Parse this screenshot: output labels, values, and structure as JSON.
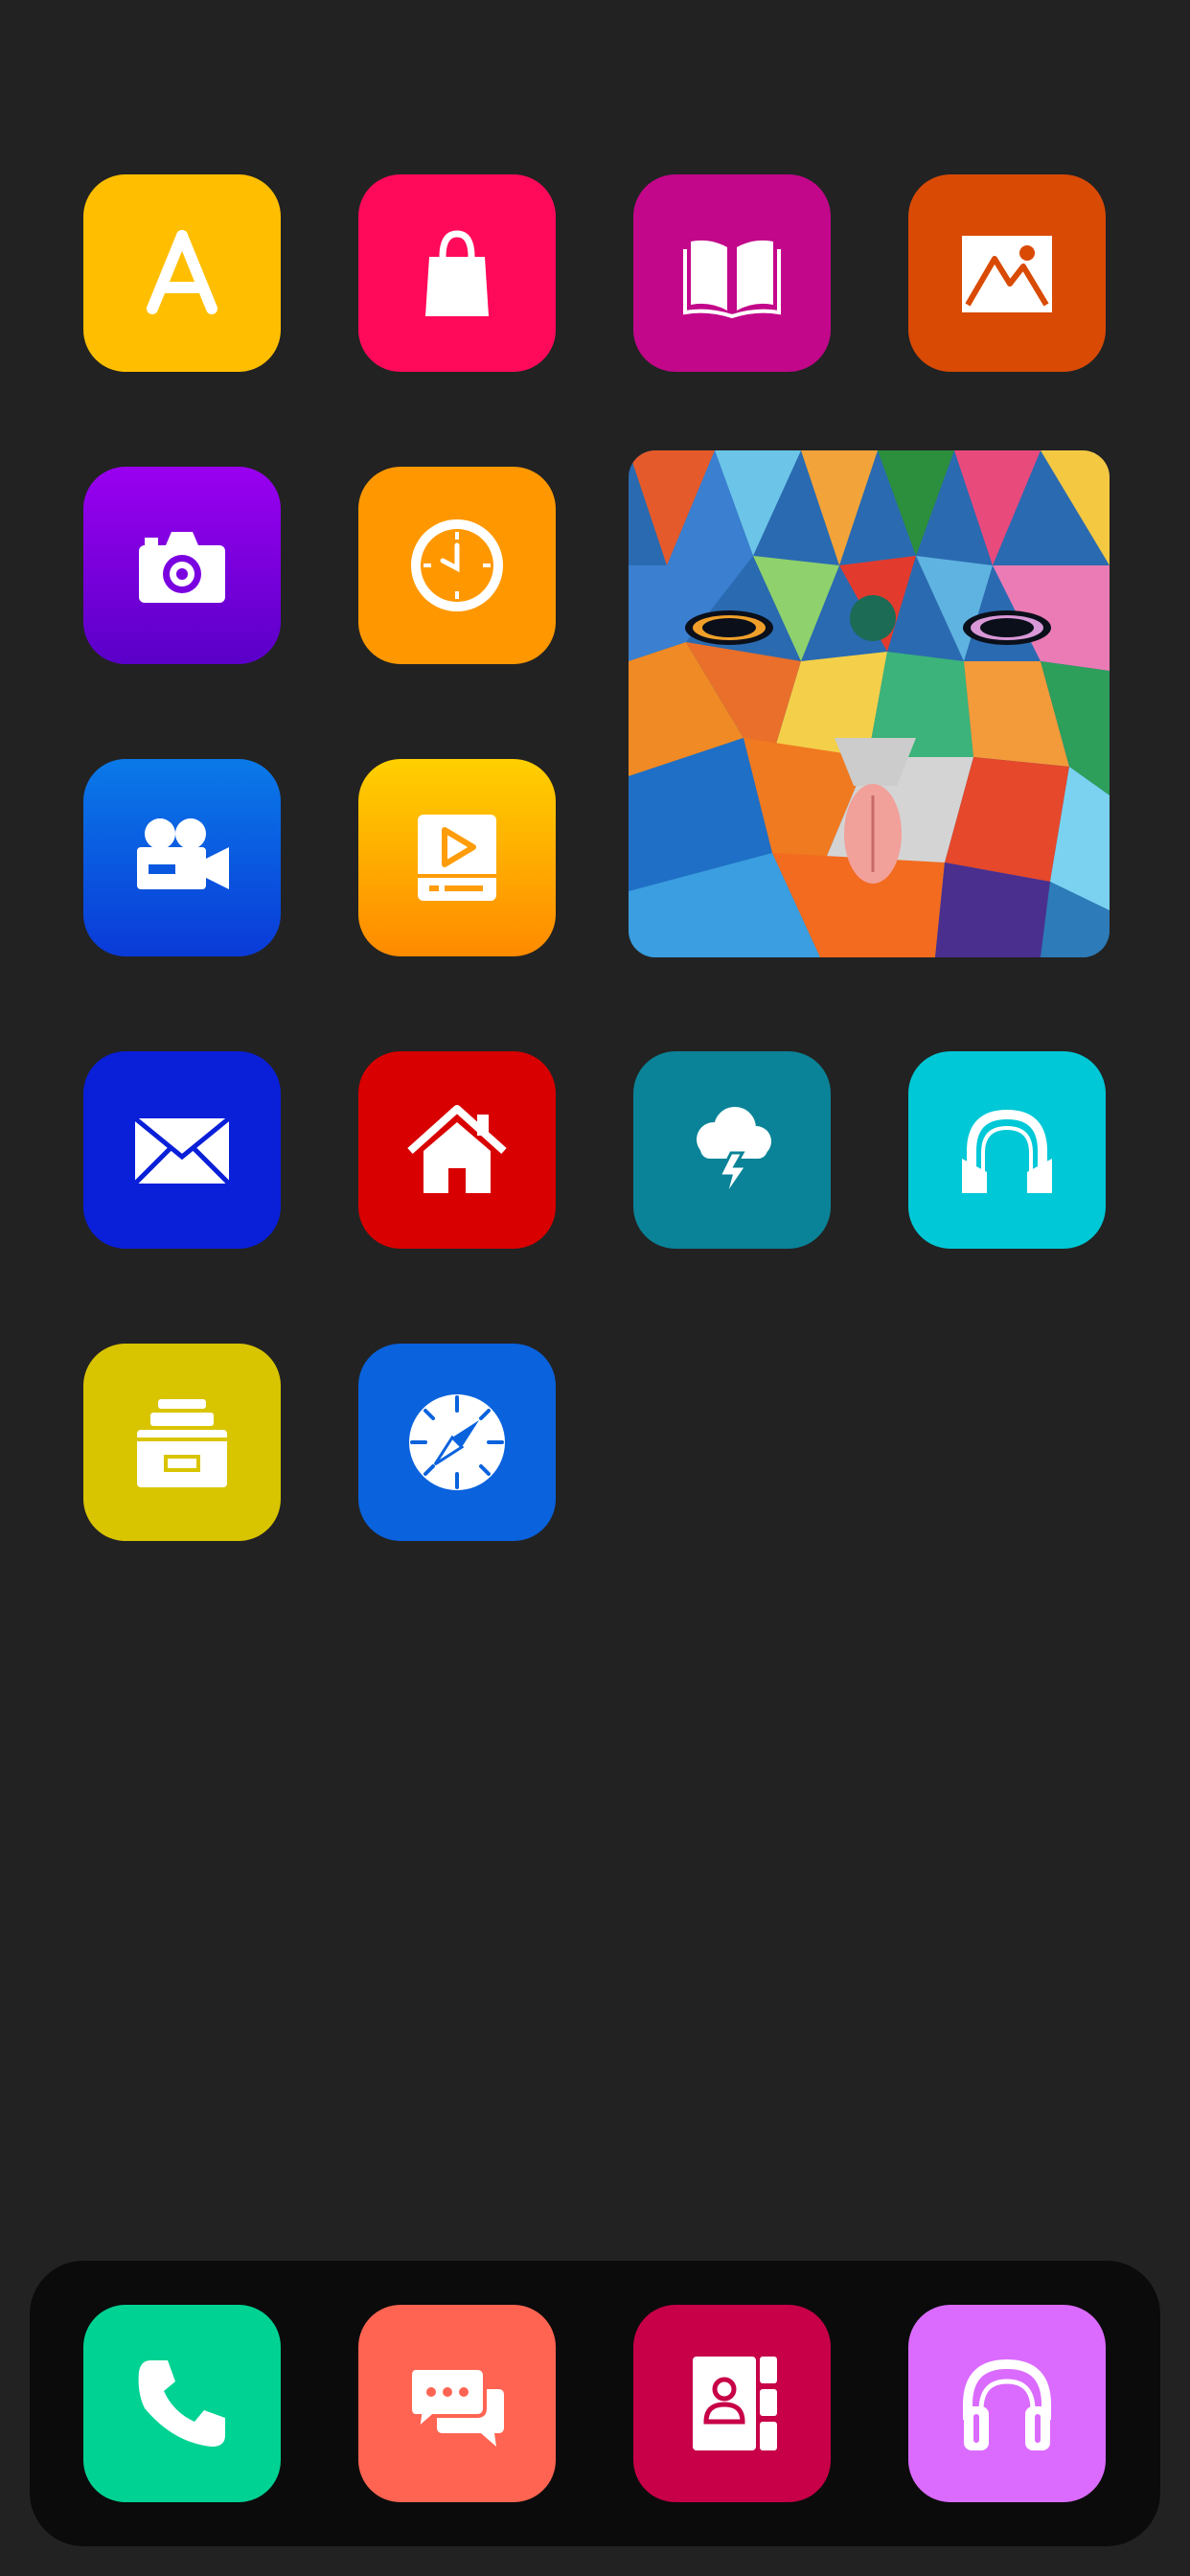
{
  "home_screen": {
    "apps": [
      {
        "id": "app-store",
        "icon": "app-store-icon",
        "color": "#FFBF00"
      },
      {
        "id": "shopping",
        "icon": "shopping-bag-icon",
        "color": "#FF0A5A"
      },
      {
        "id": "books",
        "icon": "open-book-icon",
        "color": "#C2078A"
      },
      {
        "id": "photos",
        "icon": "mountain-photo-icon",
        "color": "#D94A05"
      },
      {
        "id": "camera",
        "icon": "camera-icon",
        "color": "#7A00E0"
      },
      {
        "id": "clock",
        "icon": "clock-icon",
        "color": "#FF9800"
      },
      {
        "id": "video-camera",
        "icon": "video-camera-icon",
        "color": "#0A58E0"
      },
      {
        "id": "video-player",
        "icon": "video-player-icon",
        "color": "#FF9C0A"
      },
      {
        "id": "mail",
        "icon": "envelope-icon",
        "color": "#0A1FD8"
      },
      {
        "id": "home",
        "icon": "house-icon",
        "color": "#D80000"
      },
      {
        "id": "weather",
        "icon": "storm-cloud-icon",
        "color": "#0A8398"
      },
      {
        "id": "music",
        "icon": "headphones-icon",
        "color": "#00C8D7"
      },
      {
        "id": "files",
        "icon": "archive-box-icon",
        "color": "#D9C400"
      },
      {
        "id": "safari",
        "icon": "compass-icon",
        "color": "#0A62DD"
      }
    ],
    "widget": {
      "icon": "colorful-mural-image"
    }
  },
  "dock": {
    "apps": [
      {
        "id": "phone",
        "icon": "phone-icon",
        "color": "#00D293"
      },
      {
        "id": "messages",
        "icon": "chat-bubbles-icon",
        "color": "#FF6452"
      },
      {
        "id": "contacts",
        "icon": "contacts-book-icon",
        "color": "#C70047"
      },
      {
        "id": "podcasts",
        "icon": "headphones-icon",
        "color": "#DB6BFF"
      }
    ]
  }
}
